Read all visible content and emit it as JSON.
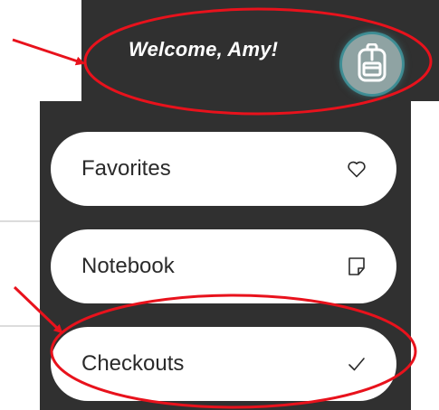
{
  "header": {
    "welcome_text": "Welcome, Amy!"
  },
  "avatar": {
    "icon": "backpack-icon",
    "ring_color": "#46bec8"
  },
  "menu": {
    "items": [
      {
        "label": "Favorites",
        "icon": "heart-icon"
      },
      {
        "label": "Notebook",
        "icon": "note-icon"
      },
      {
        "label": "Checkouts",
        "icon": "checkmark-icon"
      }
    ]
  },
  "colors": {
    "panel_bg": "#303030",
    "pill_bg": "#ffffff",
    "annotation": "#e8121c"
  }
}
